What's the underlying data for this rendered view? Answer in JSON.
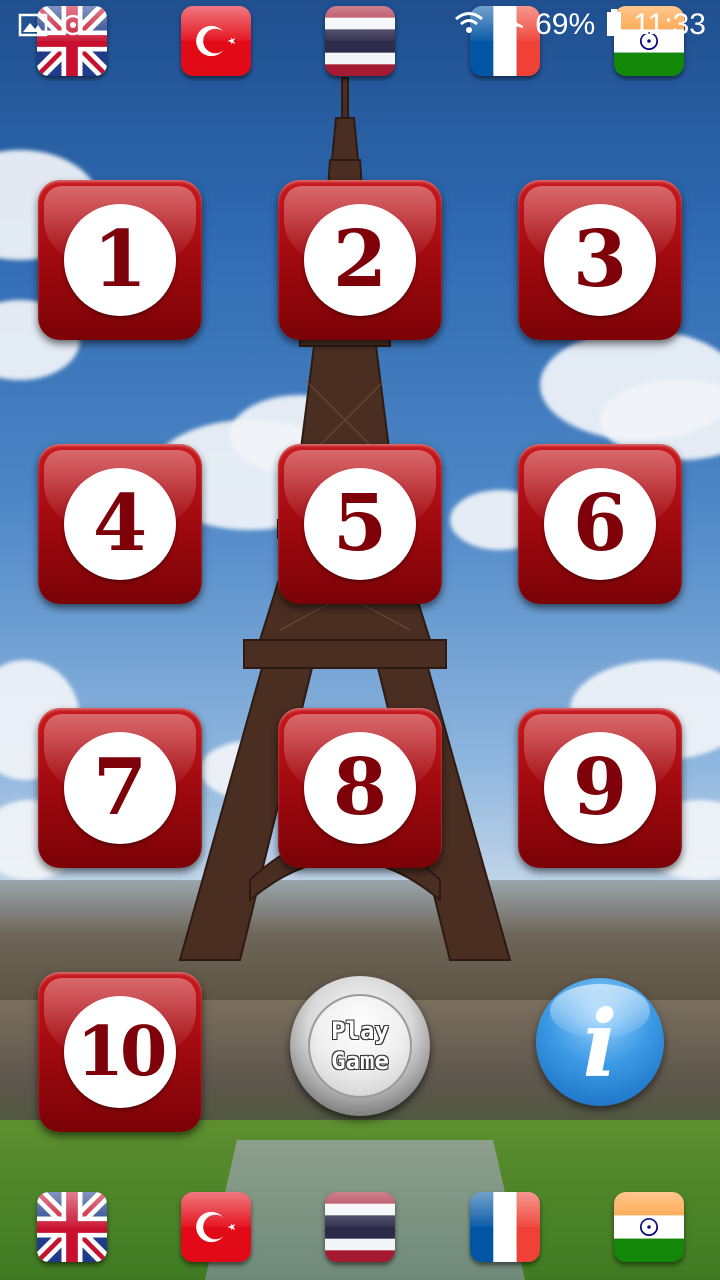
{
  "status_bar": {
    "battery_percent": "69%",
    "time": "11:33",
    "icons": [
      "image-icon",
      "cast-icon",
      "wifi-icon",
      "airplane-mode-icon",
      "battery-icon"
    ]
  },
  "flags": [
    {
      "name": "United Kingdom",
      "icon": "uk-flag-icon"
    },
    {
      "name": "Turkey",
      "icon": "turkey-flag-icon"
    },
    {
      "name": "Thailand",
      "icon": "thailand-flag-icon"
    },
    {
      "name": "France",
      "icon": "france-flag-icon"
    },
    {
      "name": "India",
      "icon": "india-flag-icon"
    }
  ],
  "levels": [
    "1",
    "2",
    "3",
    "4",
    "5",
    "6",
    "7",
    "8",
    "9",
    "10"
  ],
  "play_button": {
    "line1": "Play",
    "line2": "Game"
  },
  "info_button": {
    "glyph": "i"
  },
  "colors": {
    "tile_red": "#a30a10",
    "number_red": "#7e0008",
    "info_blue": "#2f86d6"
  }
}
